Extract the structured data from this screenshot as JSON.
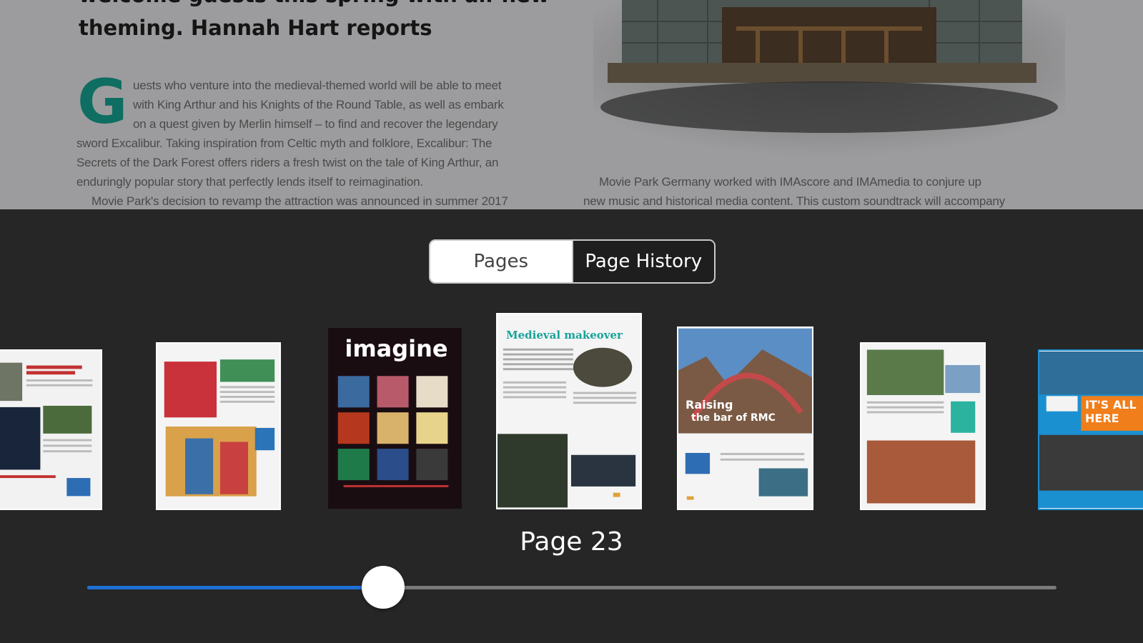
{
  "article": {
    "headline_lines": [
      "welcome guests this spring with all-new",
      "theming. Hannah Hart reports"
    ],
    "drop_cap": "G",
    "left_column": [
      "uests who venture into the medieval-themed world will be able to meet",
      "with King Arthur and his Knights of the Round Table, as well as embark",
      "on a quest given by Merlin himself – to find and recover the legendary",
      "sword Excalibur. Taking inspiration from Celtic myth and folklore, Excalibur: The",
      "Secrets of the Dark Forest offers riders a fresh twist on the tale of King Arthur, an",
      "enduringly popular story that perfectly lends itself to reimagination.",
      "Movie Park's decision to revamp the attraction was announced in summer 2017"
    ],
    "right_column": [
      "Movie Park Germany worked with IMAscore and IMAmedia to conjure up",
      "new music and historical media content. This custom soundtrack will accompany"
    ]
  },
  "segmented": {
    "pages_label": "Pages",
    "history_label": "Page History",
    "selected": "Pages"
  },
  "thumbnails": {
    "imagine_logo": "imagine",
    "medieval_title": "Medieval makeover",
    "rmc_title_1": "Raising",
    "rmc_title_2": "the bar of RMC",
    "here_text": "IT'S ALL HERE"
  },
  "page_indicator": {
    "label": "Page 23",
    "slider_fraction": 0.305
  },
  "colors": {
    "accent": "#1f6fd6",
    "background": "#262626",
    "article_green": "#0e6e62"
  }
}
